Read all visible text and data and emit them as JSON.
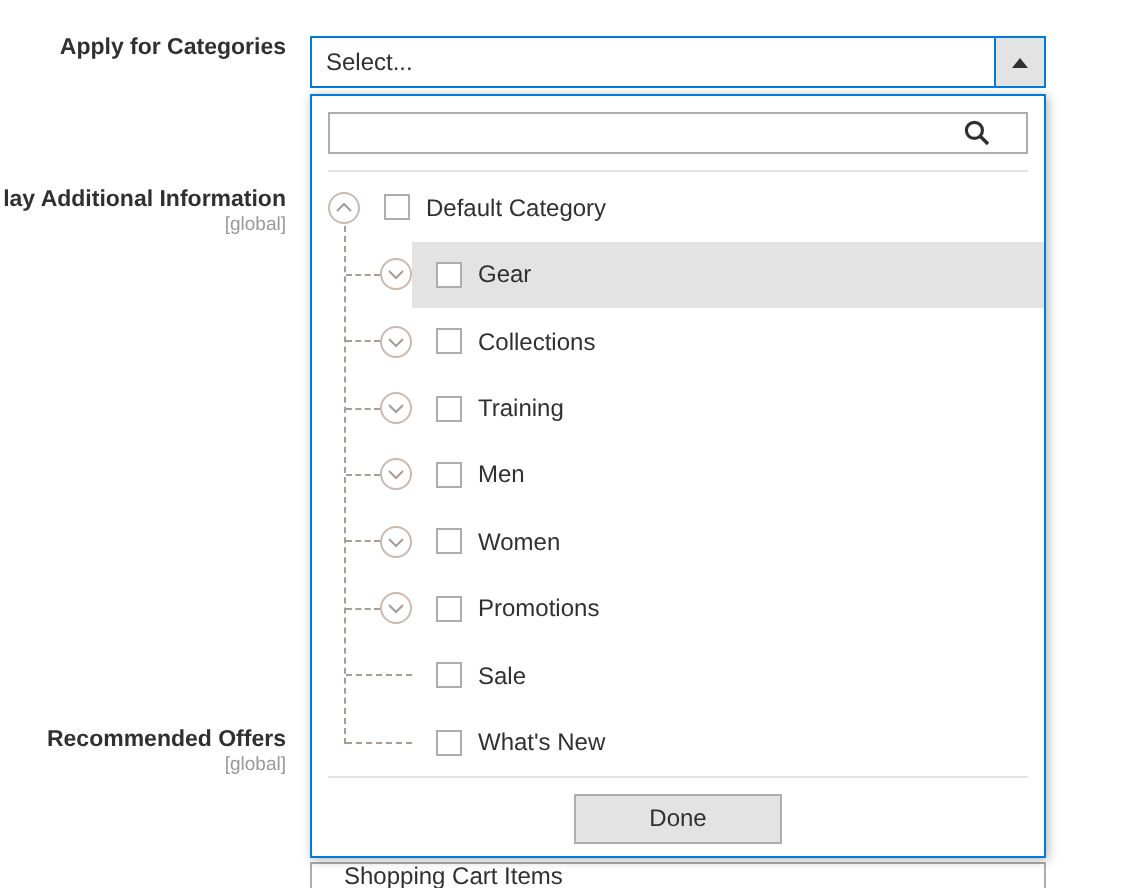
{
  "form": {
    "fields": [
      {
        "label": "Apply for Categories",
        "kind": "select"
      },
      {
        "label": "lay Additional Information",
        "scope": "[global]",
        "kind": "plain"
      },
      {
        "label": "Recommended Offers",
        "scope": "[global]",
        "kind": "value",
        "value": "Shopping Cart Items"
      }
    ]
  },
  "select": {
    "value": "Select...",
    "open": true
  },
  "dropdown": {
    "tree": [
      {
        "label": "Default Category",
        "kind": "branch",
        "expanded": true,
        "checked": false,
        "highlighted": false,
        "children": [
          {
            "label": "Gear",
            "kind": "branch",
            "expanded": false,
            "checked": false,
            "highlighted": true
          },
          {
            "label": "Collections",
            "kind": "branch",
            "expanded": false,
            "checked": false,
            "highlighted": false
          },
          {
            "label": "Training",
            "kind": "branch",
            "expanded": false,
            "checked": false,
            "highlighted": false
          },
          {
            "label": "Men",
            "kind": "branch",
            "expanded": false,
            "checked": false,
            "highlighted": false
          },
          {
            "label": "Women",
            "kind": "branch",
            "expanded": false,
            "checked": false,
            "highlighted": false
          },
          {
            "label": "Promotions",
            "kind": "branch",
            "expanded": false,
            "checked": false,
            "highlighted": false
          },
          {
            "label": "Sale",
            "kind": "leaf",
            "checked": false,
            "highlighted": false
          },
          {
            "label": "What's New",
            "kind": "leaf",
            "checked": false,
            "highlighted": false
          }
        ]
      }
    ],
    "done_button": "Done"
  }
}
